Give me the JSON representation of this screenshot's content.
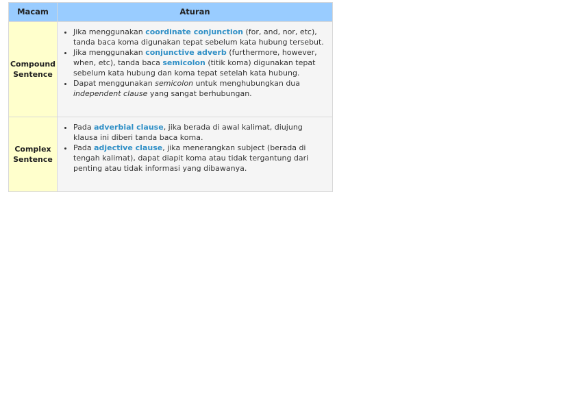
{
  "headers": {
    "macam": "Macam",
    "aturan": "Aturan"
  },
  "rows": [
    {
      "name": "Compound Sentence",
      "name_lines": [
        "Compound",
        "Sentence"
      ],
      "bullets": [
        {
          "pre": "Jika menggunakan ",
          "kw": "coordinate conjunction",
          "post": " (for, and, nor, etc), tanda baca koma digunakan tepat sebelum kata hubung tersebut."
        },
        {
          "pre": "Jika menggunakan ",
          "kw": "conjunctive adverb",
          "mid": " (furthermore, however, when, etc), tanda baca ",
          "kw2": "semicolon",
          "post": " (titik koma) digunakan tepat sebelum kata hubung dan koma tepat setelah kata hubung."
        },
        {
          "pre": "Dapat menggunakan ",
          "em": "semicolon",
          "mid": " untuk menghubungkan dua ",
          "em2": "independent clause",
          "post": " yang sangat berhubungan."
        }
      ]
    },
    {
      "name": "Complex Sentence",
      "name_lines": [
        "Complex",
        "Sentence"
      ],
      "bullets": [
        {
          "pre": "Pada ",
          "kw": "adverbial clause",
          "post": ", jika berada di awal kalimat, diujung klausa ini diberi tanda baca koma."
        },
        {
          "pre": "Pada ",
          "kw": "adjective clause",
          "post": ", jika menerangkan subject (berada di tengah kalimat), dapat diapit koma atau tidak tergantung dari penting atau tidak informasi yang dibawanya."
        }
      ]
    }
  ],
  "colors": {
    "header_bg": "#99ccff",
    "macam_bg": "#ffffcc",
    "aturan_bg": "#f5f5f5",
    "keyword": "#2f8fc6"
  }
}
